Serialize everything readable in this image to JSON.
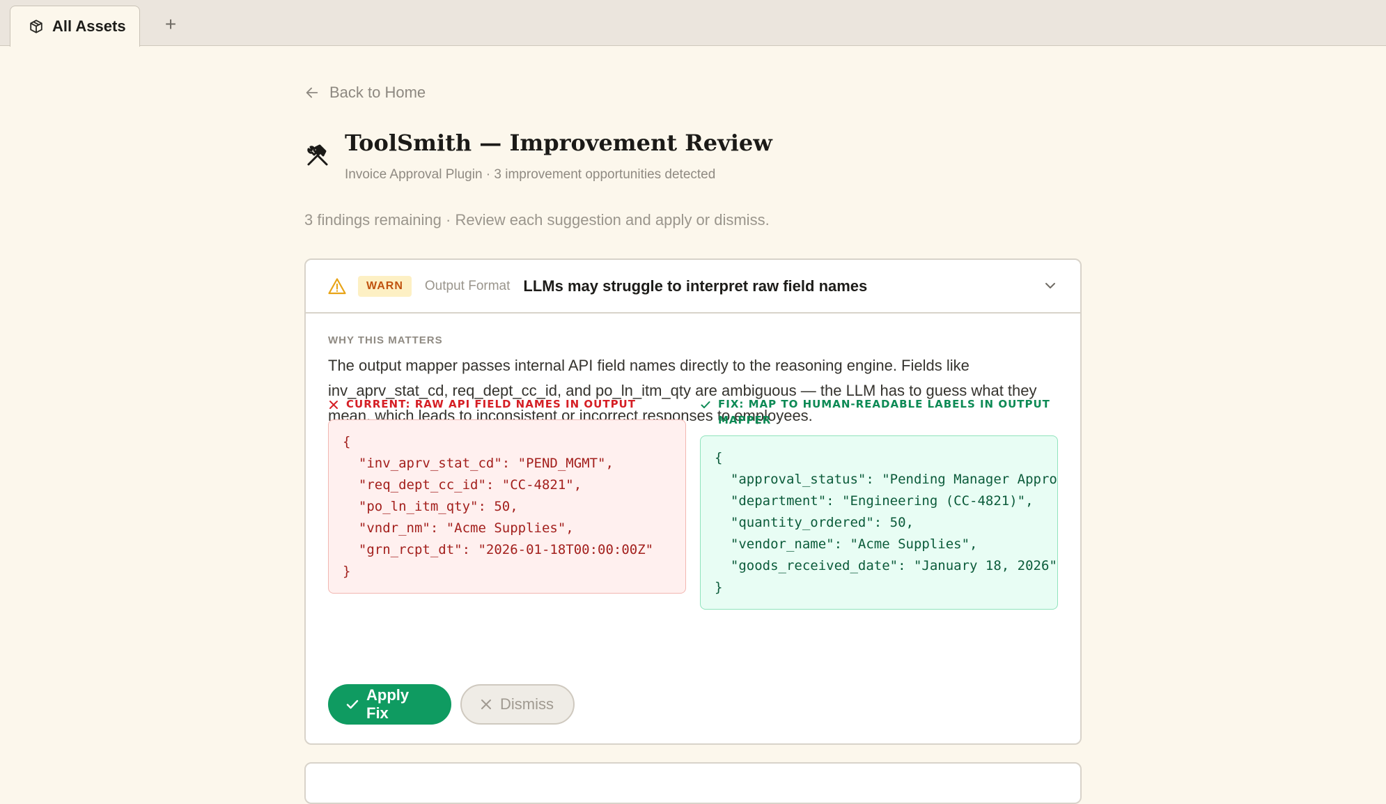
{
  "tabbar": {
    "active_tab": "All Assets",
    "add_tab_symbol": "+"
  },
  "nav": {
    "back_label": "Back to Home"
  },
  "header": {
    "title": "ToolSmith — Improvement Review",
    "subtitle": "Invoice Approval Plugin · 3 improvement opportunities detected",
    "summary": "3 findings remaining · Review each suggestion and apply or dismiss."
  },
  "finding": {
    "severity": "WARN",
    "category": "Output Format",
    "title": "LLMs may struggle to interpret raw field names",
    "why_label": "WHY THIS MATTERS",
    "why_text": "The output mapper passes internal API field names directly to the reasoning engine. Fields like inv_aprv_stat_cd, req_dept_cc_id, and po_ln_itm_qty are ambiguous — the LLM has to guess what they mean, which leads to inconsistent or incorrect responses to employees.",
    "current_label": "CURRENT: RAW API FIELD NAMES IN OUTPUT",
    "current_code": "{\n  \"inv_aprv_stat_cd\": \"PEND_MGMT\",\n  \"req_dept_cc_id\": \"CC-4821\",\n  \"po_ln_itm_qty\": 50,\n  \"vndr_nm\": \"Acme Supplies\",\n  \"grn_rcpt_dt\": \"2026-01-18T00:00:00Z\"\n}",
    "fix_label": "FIX: MAP TO HUMAN-READABLE LABELS IN OUTPUT MAPPER",
    "fix_code": "{\n  \"approval_status\": \"Pending Manager Appro\n  \"department\": \"Engineering (CC-4821)\",\n  \"quantity_ordered\": 50,\n  \"vendor_name\": \"Acme Supplies\",\n  \"goods_received_date\": \"January 18, 2026\"\n}",
    "apply_label": "Apply Fix",
    "dismiss_label": "Dismiss"
  },
  "colors": {
    "page_bg": "#fcf7ec",
    "warn_badge_bg": "#fdf0c4",
    "warn_badge_text": "#c0530f",
    "error_red": "#d51f25",
    "success_green": "#0f9b61"
  },
  "icons": {
    "tab": "package-icon",
    "back": "arrow-left-icon",
    "title": "hammer-wrench-icon",
    "severity": "warning-triangle-icon",
    "collapse": "chevron-down-icon",
    "current": "x-icon",
    "fix": "check-icon"
  }
}
